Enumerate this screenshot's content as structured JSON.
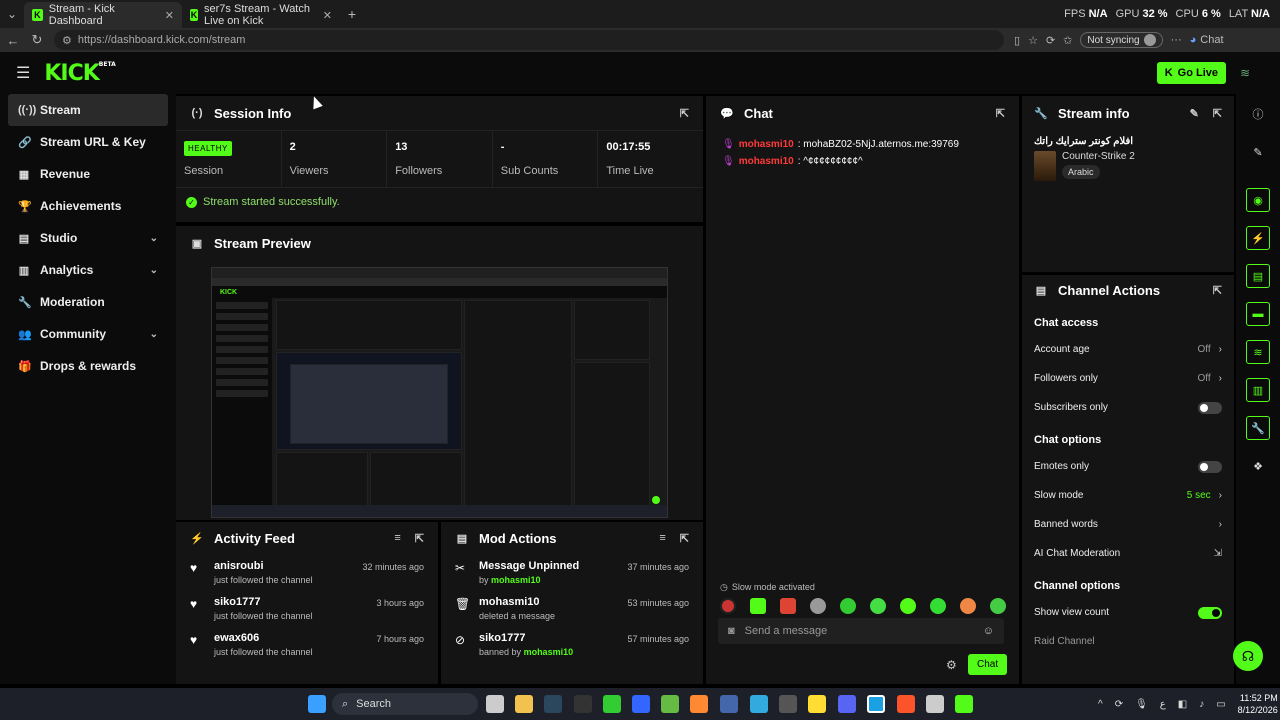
{
  "browser": {
    "tabs": [
      {
        "title": "Stream - Kick Dashboard",
        "active": true
      },
      {
        "title": "ser7s Stream - Watch Live on Kick",
        "active": false
      }
    ],
    "stats": {
      "fps_label": "FPS",
      "fps": "N/A",
      "gpu_label": "GPU",
      "gpu": "32 %",
      "cpu_label": "CPU",
      "cpu": "6 %",
      "lat_label": "LAT",
      "lat": "N/A"
    },
    "url": "https://dashboard.kick.com/stream",
    "sync_label": "Not syncing",
    "copilot_label": "Chat"
  },
  "header": {
    "logo": "KICK",
    "logo_sup": "BETA",
    "go_live": "Go Live"
  },
  "sidebar": {
    "items": [
      {
        "label": "Stream",
        "icon": "broadcast-icon",
        "glyph": "((·))",
        "active": true,
        "expandable": false
      },
      {
        "label": "Stream URL & Key",
        "icon": "link-icon",
        "glyph": "🔗",
        "active": false,
        "expandable": false
      },
      {
        "label": "Revenue",
        "icon": "chart-icon",
        "glyph": "▦",
        "active": false,
        "expandable": false
      },
      {
        "label": "Achievements",
        "icon": "trophy-icon",
        "glyph": "🏆",
        "active": false,
        "expandable": false
      },
      {
        "label": "Studio",
        "icon": "studio-icon",
        "glyph": "▤",
        "active": false,
        "expandable": true
      },
      {
        "label": "Analytics",
        "icon": "analytics-icon",
        "glyph": "▥",
        "active": false,
        "expandable": true
      },
      {
        "label": "Moderation",
        "icon": "wrench-icon",
        "glyph": "🔧",
        "active": false,
        "expandable": false
      },
      {
        "label": "Community",
        "icon": "community-icon",
        "glyph": "👥",
        "active": false,
        "expandable": true
      },
      {
        "label": "Drops & rewards",
        "icon": "gift-icon",
        "glyph": "🎁",
        "active": false,
        "expandable": false
      }
    ]
  },
  "session": {
    "title": "Session Info",
    "status_badge": "HEALTHY",
    "status_label": "Session",
    "stats": [
      {
        "value": "2",
        "label": "Viewers"
      },
      {
        "value": "13",
        "label": "Followers"
      },
      {
        "value": "-",
        "label": "Sub Counts"
      },
      {
        "value": "00:17:55",
        "label": "Time Live"
      }
    ],
    "success_message": "Stream started successfully."
  },
  "preview": {
    "title": "Stream Preview"
  },
  "activity": {
    "title": "Activity Feed",
    "items": [
      {
        "name": "anisroubi",
        "sub": "just followed the channel",
        "time": "32 minutes ago"
      },
      {
        "name": "siko1777",
        "sub": "just followed the channel",
        "time": "3 hours ago"
      },
      {
        "name": "ewax606",
        "sub": "just followed the channel",
        "time": "7 hours ago"
      }
    ]
  },
  "mod": {
    "title": "Mod Actions",
    "items": [
      {
        "name": "Message Unpinned",
        "pre": "by",
        "user": "mohasmi10",
        "time": "37 minutes ago"
      },
      {
        "name": "mohasmi10",
        "pre": "deleted a message",
        "user": "",
        "time": "53 minutes ago"
      },
      {
        "name": "siko1777",
        "pre": "banned by",
        "user": "mohasmi10",
        "time": "57 minutes ago"
      }
    ]
  },
  "chat": {
    "title": "Chat",
    "messages": [
      {
        "user": "mohasmi10",
        "text": ": mohaBZ02-5NjJ.aternos.me:39769"
      },
      {
        "user": "mohasmi10",
        "text": ": ^¢¢¢¢¢¢¢¢¢^"
      }
    ],
    "slow_mode": "Slow mode activated",
    "placeholder": "Send a message",
    "send": "Chat"
  },
  "stream_info": {
    "title": "Stream info",
    "stream_title": "افلام كونتر سترايك راتك",
    "game": "Counter-Strike 2",
    "language": "Arabic"
  },
  "channel_actions": {
    "title": "Channel Actions",
    "chat_access": "Chat access",
    "account_age": "Account age",
    "account_age_val": "Off",
    "followers_only": "Followers only",
    "followers_only_val": "Off",
    "subscribers_only": "Subscribers only",
    "chat_options": "Chat options",
    "emotes_only": "Emotes only",
    "slow_mode": "Slow mode",
    "slow_mode_val": "5 sec",
    "banned_words": "Banned words",
    "ai_moderation": "AI Chat Moderation",
    "channel_options": "Channel options",
    "show_view_count": "Show view count",
    "raid_channel": "Raid Channel"
  },
  "taskbar": {
    "search": "Search",
    "time": "11:52 PM",
    "date": "8/12/2026"
  },
  "colors": {
    "accent": "#53fc18",
    "panel": "#141414",
    "bg": "#000000",
    "chat_user": "#ff3a3a"
  }
}
